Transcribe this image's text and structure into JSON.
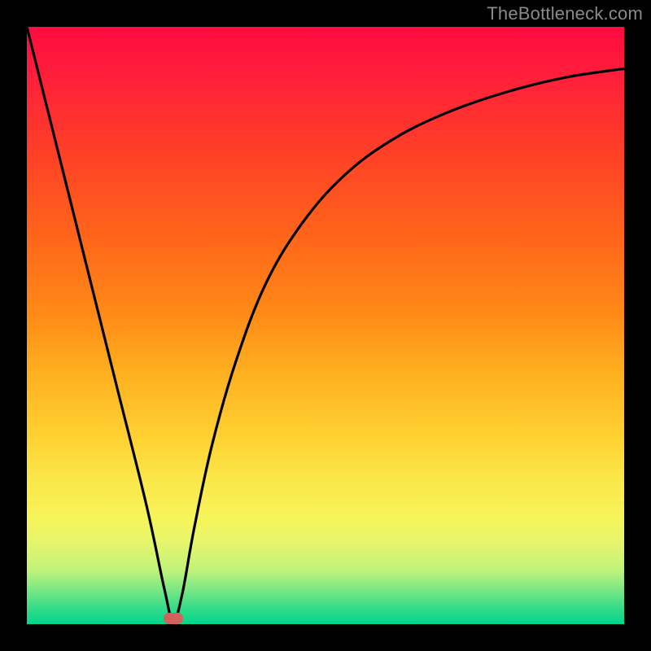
{
  "watermark": "TheBottleneck.com",
  "colors": {
    "frame_bg": "#000000",
    "gradient_top": "#ff0b40",
    "gradient_bottom": "#00d68c",
    "curve": "#000000",
    "marker": "#d1635c",
    "watermark": "#8a8a8a"
  },
  "chart_data": {
    "type": "line",
    "title": "",
    "xlabel": "",
    "ylabel": "",
    "xlim": [
      0,
      100
    ],
    "ylim": [
      0,
      100
    ],
    "annotations": [
      {
        "type": "marker",
        "x": 24.5,
        "y": 1.0
      }
    ],
    "series": [
      {
        "name": "curve",
        "x": [
          0,
          5,
          10,
          15,
          20,
          23,
          24.5,
          26,
          28,
          31,
          35,
          40,
          46,
          53,
          61,
          70,
          80,
          90,
          100
        ],
        "y": [
          100,
          80,
          60,
          40,
          20,
          6,
          0.5,
          5,
          16,
          30,
          44,
          57,
          67,
          75,
          81,
          85.5,
          89,
          91.5,
          93
        ]
      }
    ]
  }
}
